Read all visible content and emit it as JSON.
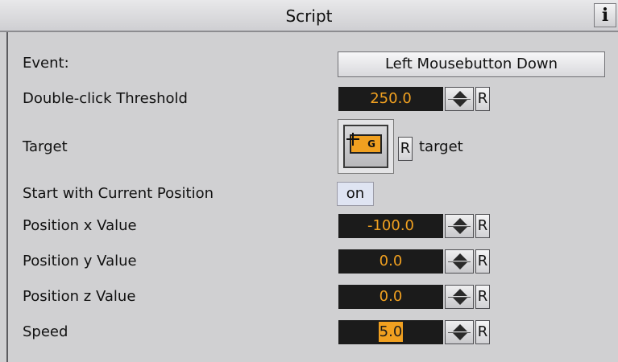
{
  "header": {
    "title": "Script",
    "info_label": "i"
  },
  "rows": {
    "event": {
      "label": "Event:",
      "value": "Left Mousebutton Down"
    },
    "double_click": {
      "label": "Double-click Threshold",
      "value": "250.0",
      "reset": "R"
    },
    "target": {
      "label": "Target",
      "icon_letter": "G",
      "reset": "R",
      "value": "target"
    },
    "start_pos": {
      "label": "Start with Current Position",
      "value": "on"
    },
    "pos_x": {
      "label": "Position x Value",
      "value": "-100.0",
      "reset": "R"
    },
    "pos_y": {
      "label": "Position y Value",
      "value": "0.0",
      "reset": "R"
    },
    "pos_z": {
      "label": "Position z Value",
      "value": "0.0",
      "reset": "R"
    },
    "speed": {
      "label": "Speed",
      "value": "5.0",
      "reset": "R"
    }
  },
  "colors": {
    "value_text": "#f0a020",
    "value_bg": "#1b1b1b",
    "panel_bg": "#d0d0d2",
    "toggle_bg": "#dfe4f2"
  }
}
